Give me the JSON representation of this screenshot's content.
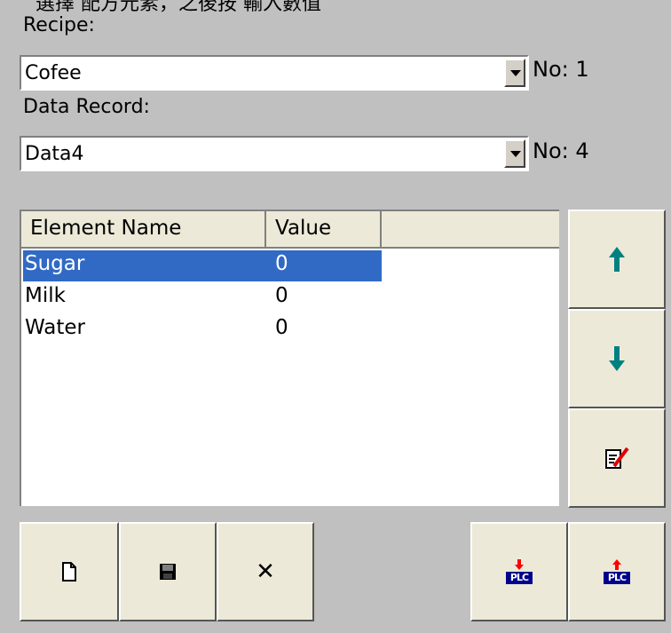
{
  "top_hint": "選擇  配方元素，之後按        輸入數值",
  "recipe": {
    "label": "Recipe:",
    "value": "Cofee",
    "no": "No: 1"
  },
  "record": {
    "label": "Data Record:",
    "value": "Data4",
    "no": "No: 4"
  },
  "table": {
    "headers": [
      "Element Name",
      "Value"
    ],
    "rows": [
      {
        "name": "Sugar",
        "value": "0",
        "selected": true
      },
      {
        "name": "Milk",
        "value": "0",
        "selected": false
      },
      {
        "name": "Water",
        "value": "0",
        "selected": false
      }
    ]
  },
  "side_buttons": {
    "up": "arrow-up-icon",
    "down": "arrow-down-icon",
    "edit": "edit-icon"
  },
  "bottom_buttons": {
    "new": "new-file-icon",
    "save": "save-disk-icon",
    "delete": "delete-x-icon",
    "delete_glyph": "✕",
    "plc_label": "PLC",
    "write": "write-to-plc-icon",
    "read": "read-from-plc-icon"
  },
  "colors": {
    "selection": "#316ac5",
    "arrow_teal": "#008080",
    "plc_arrow": "#ff0000",
    "plc_box": "#00008b"
  }
}
